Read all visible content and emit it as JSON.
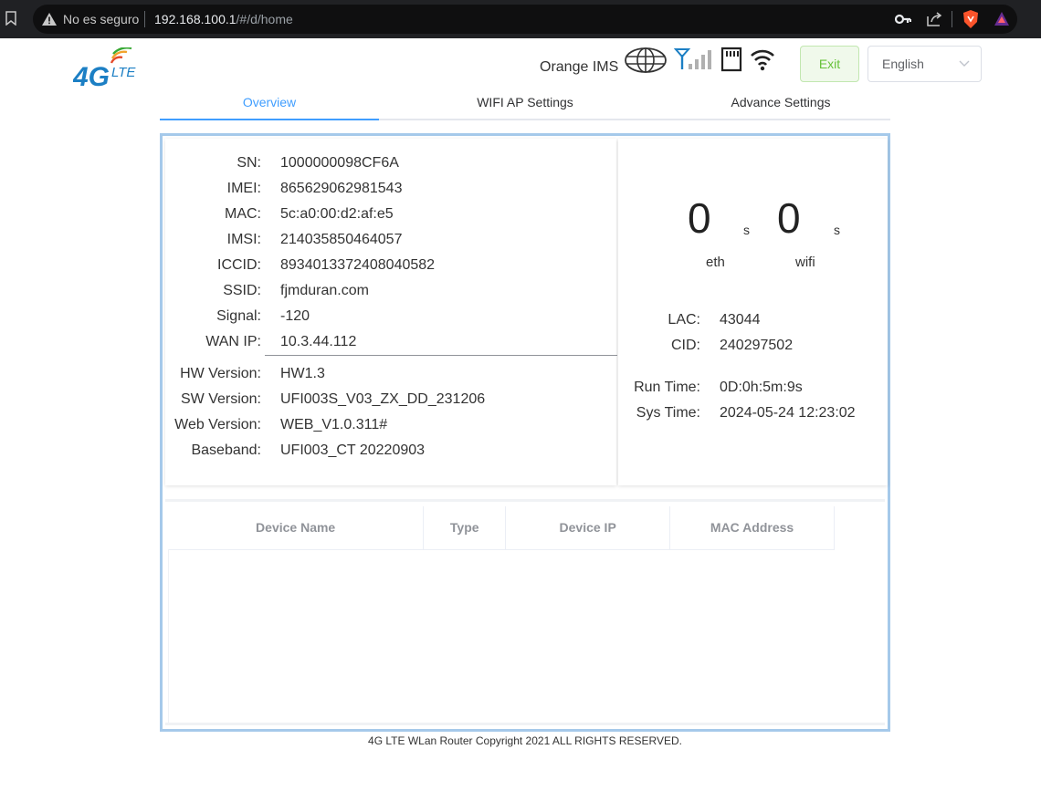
{
  "browser": {
    "security_label": "No es seguro",
    "url_host": "192.168.100.1",
    "url_path": "/#/d/home"
  },
  "header": {
    "logo_main": "4G",
    "logo_sub": "LTE",
    "carrier": "Orange IMS",
    "exit_label": "Exit",
    "language": "English",
    "icons": [
      "globe-icon",
      "signal-icon",
      "sim-card-icon",
      "wifi-icon"
    ]
  },
  "tabs": [
    {
      "label": "Overview",
      "active": true
    },
    {
      "label": "WIFI AP Settings",
      "active": false
    },
    {
      "label": "Advance Settings",
      "active": false
    }
  ],
  "device_info": [
    {
      "label": "SN:",
      "value": "1000000098CF6A"
    },
    {
      "label": "IMEI:",
      "value": "865629062981543"
    },
    {
      "label": "MAC:",
      "value": "5c:a0:00:d2:af:e5"
    },
    {
      "label": "IMSI:",
      "value": "214035850464057"
    },
    {
      "label": "ICCID:",
      "value": "8934013372408040582"
    },
    {
      "label": "SSID:",
      "value": "fjmduran.com"
    },
    {
      "label": "Signal:",
      "value": "-120"
    },
    {
      "label": "WAN IP:",
      "value": "10.3.44.112"
    }
  ],
  "version_info": [
    {
      "label": "HW Version:",
      "value": "HW1.3"
    },
    {
      "label": "SW Version:",
      "value": "UFI003S_V03_ZX_DD_231206"
    },
    {
      "label": "Web Version:",
      "value": "WEB_V1.0.311#"
    },
    {
      "label": "Baseband:",
      "value": "UFI003_CT 20220903"
    }
  ],
  "traffic": {
    "eth_value": "0",
    "eth_unit": "s",
    "eth_label": "eth",
    "wifi_value": "0",
    "wifi_unit": "s",
    "wifi_label": "wifi"
  },
  "cell_info": [
    {
      "label": "LAC:",
      "value": "43044"
    },
    {
      "label": "CID:",
      "value": "240297502"
    }
  ],
  "time_info": [
    {
      "label": "Run Time:",
      "value": "0D:0h:5m:9s"
    },
    {
      "label": "Sys Time:",
      "value": "2024-05-24 12:23:02"
    }
  ],
  "device_table": {
    "columns": [
      "Device Name",
      "Type",
      "Device IP",
      "MAC Address"
    ],
    "rows": []
  },
  "footer": "4G LTE WLan Router Copyright 2021 ALL RIGHTS RESERVED."
}
